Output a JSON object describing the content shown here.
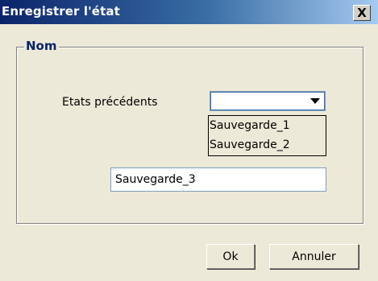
{
  "window": {
    "title": "Enregistrer l'état",
    "close_label": "X"
  },
  "group": {
    "legend": "Nom"
  },
  "previous_states": {
    "label": "Etats précédents",
    "selected": "",
    "options": [
      "Sauvegarde_1",
      "Sauvegarde_2"
    ]
  },
  "name_field": {
    "value": "Sauvegarde_3"
  },
  "buttons": {
    "ok": "Ok",
    "cancel": "Annuler"
  }
}
